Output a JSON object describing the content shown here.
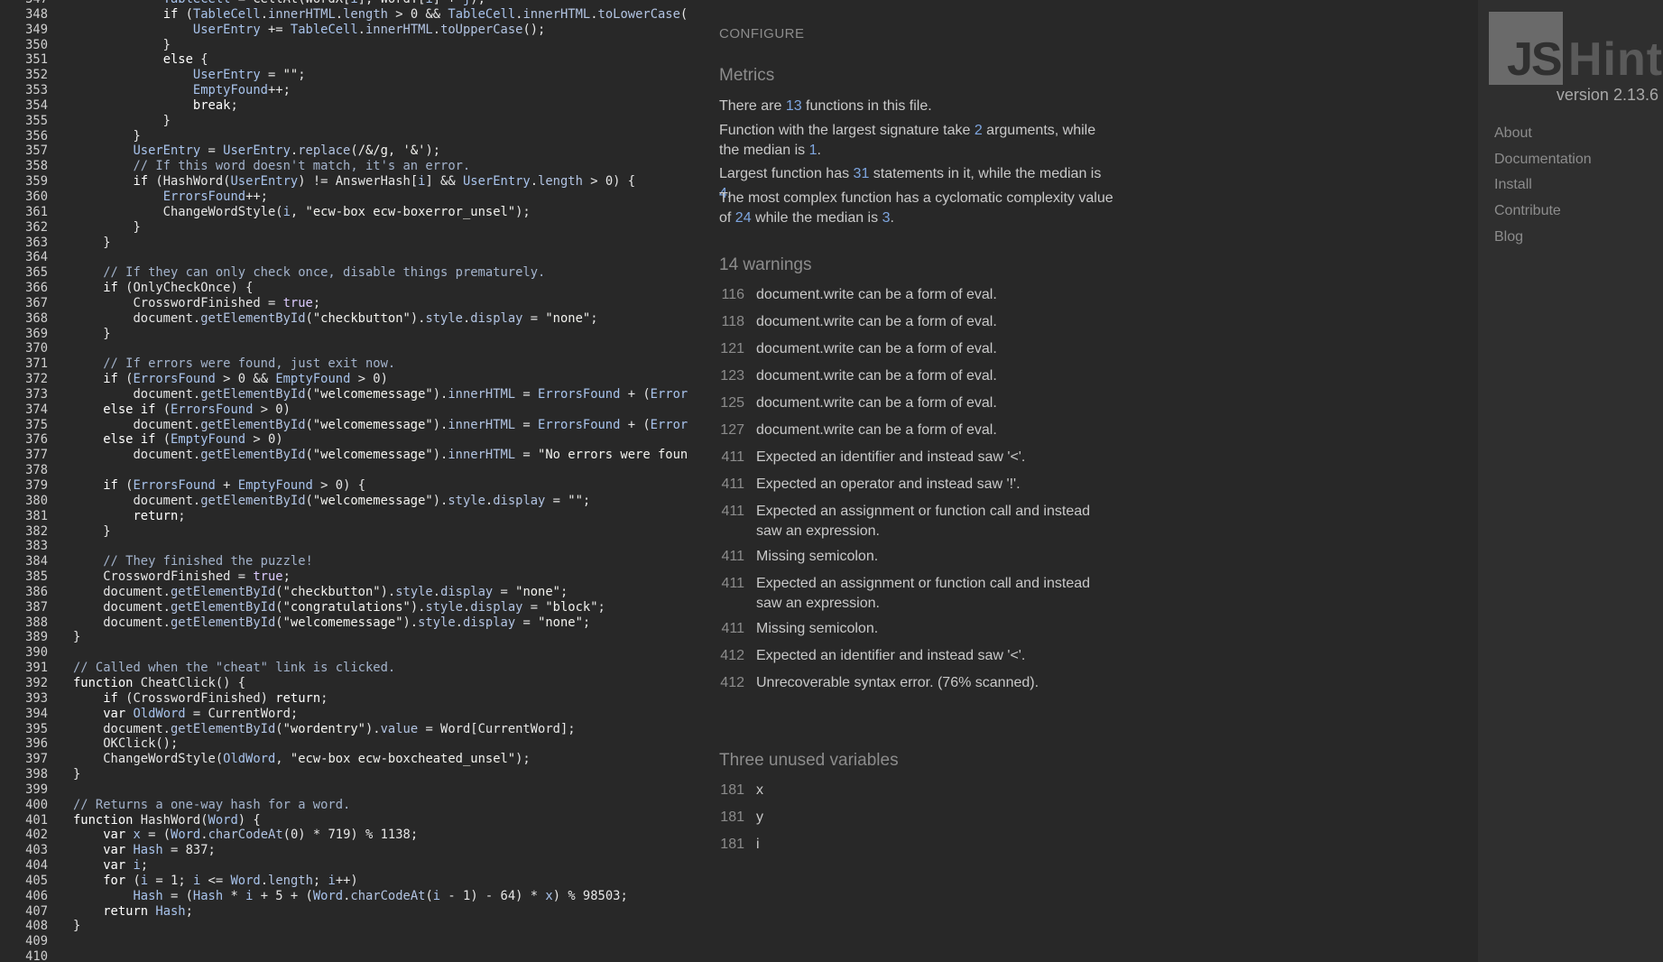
{
  "sidebar": {
    "logo_js": "JS",
    "logo_hint": "Hint",
    "version": "version 2.13.6",
    "nav": [
      "About",
      "Documentation",
      "Install",
      "Contribute",
      "Blog"
    ]
  },
  "report": {
    "configure_label": "CONFIGURE",
    "metrics_title": "Metrics",
    "metrics": {
      "functions_count": "13",
      "largest_signature": "2",
      "signature_median": "1",
      "largest_statements": "31",
      "statements_median": "4",
      "complexity_max": "24",
      "complexity_median": "3"
    },
    "warnings_title": "14 warnings",
    "warnings": [
      {
        "line": "116",
        "msg": "document.write can be a form of eval."
      },
      {
        "line": "118",
        "msg": "document.write can be a form of eval."
      },
      {
        "line": "121",
        "msg": "document.write can be a form of eval."
      },
      {
        "line": "123",
        "msg": "document.write can be a form of eval."
      },
      {
        "line": "125",
        "msg": "document.write can be a form of eval."
      },
      {
        "line": "127",
        "msg": "document.write can be a form of eval."
      },
      {
        "line": "411",
        "msg": "Expected an identifier and instead saw '<'."
      },
      {
        "line": "411",
        "msg": "Expected an operator and instead saw '!'."
      },
      {
        "line": "411",
        "msg": "Expected an assignment or function call and instead saw an expression."
      },
      {
        "line": "411",
        "msg": "Missing semicolon."
      },
      {
        "line": "411",
        "msg": "Expected an assignment or function call and instead saw an expression."
      },
      {
        "line": "411",
        "msg": "Missing semicolon."
      },
      {
        "line": "412",
        "msg": "Expected an identifier and instead saw '<'."
      },
      {
        "line": "412",
        "msg": "Unrecoverable syntax error. (76% scanned)."
      }
    ],
    "unused_title": "Three unused variables",
    "unused": [
      {
        "line": "181",
        "name": "x"
      },
      {
        "line": "181",
        "name": "y"
      },
      {
        "line": "181",
        "name": "i"
      }
    ]
  },
  "editor": {
    "lines": [
      {
        "n": "347",
        "html": "            <span class=\"var\">TableCell</span> = CellAt(WordX[<span class=\"var\">i</span>], WordY[<span class=\"var\">i</span>] + <span class=\"var\">j</span>);"
      },
      {
        "n": "348",
        "html": "            <span class=\"kw\">if</span> (<span class=\"var\">TableCell</span>.<span class=\"mth\">innerHTML</span>.<span class=\"mth\">length</span> > 0 && <span class=\"var\">TableCell</span>.<span class=\"mth\">innerHTML</span>.<span class=\"mth\">toLowerCase</span>("
      },
      {
        "n": "349",
        "html": "                <span class=\"var\">UserEntry</span> += <span class=\"var\">TableCell</span>.<span class=\"mth\">innerHTML</span>.<span class=\"mth\">toUpperCase</span>();"
      },
      {
        "n": "350",
        "html": "            }"
      },
      {
        "n": "351",
        "html": "            <span class=\"kw\">else</span> {"
      },
      {
        "n": "352",
        "html": "                <span class=\"var\">UserEntry</span> = <span class=\"str\">\"\"</span>;"
      },
      {
        "n": "353",
        "html": "                <span class=\"var\">EmptyFound</span>++;"
      },
      {
        "n": "354",
        "html": "                <span class=\"kw\">break</span>;"
      },
      {
        "n": "355",
        "html": "            }"
      },
      {
        "n": "356",
        "html": "        }"
      },
      {
        "n": "357",
        "html": "        <span class=\"var\">UserEntry</span> = <span class=\"var\">UserEntry</span>.<span class=\"mth\">replace</span>(<span class=\"str\">/&AMP;/g</span>, <span class=\"str\">'&'</span>);"
      },
      {
        "n": "358",
        "html": "        <span class=\"cmt\">// If this word doesn't match, it's an error.</span>"
      },
      {
        "n": "359",
        "html": "        <span class=\"kw\">if</span> (HashWord(<span class=\"var\">UserEntry</span>) != AnswerHash[<span class=\"var\">i</span>] && <span class=\"var\">UserEntry</span>.<span class=\"mth\">length</span> > 0) {"
      },
      {
        "n": "360",
        "html": "            <span class=\"var\">ErrorsFound</span>++;"
      },
      {
        "n": "361",
        "html": "            ChangeWordStyle(<span class=\"var\">i</span>, <span class=\"str\">\"ecw-box ecw-boxerror_unsel\"</span>);"
      },
      {
        "n": "362",
        "html": "        }"
      },
      {
        "n": "363",
        "html": "    }"
      },
      {
        "n": "364",
        "html": ""
      },
      {
        "n": "365",
        "html": "    <span class=\"cmt\">// If they can only check once, disable things prematurely.</span>"
      },
      {
        "n": "366",
        "html": "    <span class=\"kw\">if</span> (OnlyCheckOnce) {"
      },
      {
        "n": "367",
        "html": "        CrosswordFinished = <span class=\"bool\">true</span>;"
      },
      {
        "n": "368",
        "html": "        document.<span class=\"mth\">getElementById</span>(<span class=\"str\">\"checkbutton\"</span>).<span class=\"mth\">style</span>.<span class=\"mth\">display</span> = <span class=\"str\">\"none\"</span>;"
      },
      {
        "n": "369",
        "html": "    }"
      },
      {
        "n": "370",
        "html": ""
      },
      {
        "n": "371",
        "html": "    <span class=\"cmt\">// If errors were found, just exit now.</span>"
      },
      {
        "n": "372",
        "html": "    <span class=\"kw\">if</span> (<span class=\"var\">ErrorsFound</span> > 0 && <span class=\"var\">EmptyFound</span> > 0)"
      },
      {
        "n": "373",
        "html": "        document.<span class=\"mth\">getElementById</span>(<span class=\"str\">\"welcomemessage\"</span>).<span class=\"mth\">innerHTML</span> = <span class=\"var\">ErrorsFound</span> + (<span class=\"var\">Error</span>"
      },
      {
        "n": "374",
        "html": "    <span class=\"kw\">else if</span> (<span class=\"var\">ErrorsFound</span> > 0)"
      },
      {
        "n": "375",
        "html": "        document.<span class=\"mth\">getElementById</span>(<span class=\"str\">\"welcomemessage\"</span>).<span class=\"mth\">innerHTML</span> = <span class=\"var\">ErrorsFound</span> + (<span class=\"var\">Error</span>"
      },
      {
        "n": "376",
        "html": "    <span class=\"kw\">else if</span> (<span class=\"var\">EmptyFound</span> > 0)"
      },
      {
        "n": "377",
        "html": "        document.<span class=\"mth\">getElementById</span>(<span class=\"str\">\"welcomemessage\"</span>).<span class=\"mth\">innerHTML</span> = <span class=\"str\">\"No errors were foun</span>"
      },
      {
        "n": "378",
        "html": ""
      },
      {
        "n": "379",
        "html": "    <span class=\"kw\">if</span> (<span class=\"var\">ErrorsFound</span> + <span class=\"var\">EmptyFound</span> > 0) {"
      },
      {
        "n": "380",
        "html": "        document.<span class=\"mth\">getElementById</span>(<span class=\"str\">\"welcomemessage\"</span>).<span class=\"mth\">style</span>.<span class=\"mth\">display</span> = <span class=\"str\">\"\"</span>;"
      },
      {
        "n": "381",
        "html": "        <span class=\"kw\">return</span>;"
      },
      {
        "n": "382",
        "html": "    }"
      },
      {
        "n": "383",
        "html": ""
      },
      {
        "n": "384",
        "html": "    <span class=\"cmt\">// They finished the puzzle!</span>"
      },
      {
        "n": "385",
        "html": "    CrosswordFinished = <span class=\"bool\">true</span>;"
      },
      {
        "n": "386",
        "html": "    document.<span class=\"mth\">getElementById</span>(<span class=\"str\">\"checkbutton\"</span>).<span class=\"mth\">style</span>.<span class=\"mth\">display</span> = <span class=\"str\">\"none\"</span>;"
      },
      {
        "n": "387",
        "html": "    document.<span class=\"mth\">getElementById</span>(<span class=\"str\">\"congratulations\"</span>).<span class=\"mth\">style</span>.<span class=\"mth\">display</span> = <span class=\"str\">\"block\"</span>;"
      },
      {
        "n": "388",
        "html": "    document.<span class=\"mth\">getElementById</span>(<span class=\"str\">\"welcomemessage\"</span>).<span class=\"mth\">style</span>.<span class=\"mth\">display</span> = <span class=\"str\">\"none\"</span>;"
      },
      {
        "n": "389",
        "html": "}"
      },
      {
        "n": "390",
        "html": ""
      },
      {
        "n": "391",
        "html": "<span class=\"cmt\">// Called when the \"cheat\" link is clicked.</span>"
      },
      {
        "n": "392",
        "html": "<span class=\"kw\">function</span> CheatClick() {"
      },
      {
        "n": "393",
        "html": "    <span class=\"kw\">if</span> (CrosswordFinished) <span class=\"kw\">return</span>;"
      },
      {
        "n": "394",
        "html": "    <span class=\"kw\">var</span> <span class=\"var\">OldWord</span> = CurrentWord;"
      },
      {
        "n": "395",
        "html": "    document.<span class=\"mth\">getElementById</span>(<span class=\"str\">\"wordentry\"</span>).<span class=\"mth\">value</span> = Word[CurrentWord];"
      },
      {
        "n": "396",
        "html": "    OKClick();"
      },
      {
        "n": "397",
        "html": "    ChangeWordStyle(<span class=\"var\">OldWord</span>, <span class=\"str\">\"ecw-box ecw-boxcheated_unsel\"</span>);"
      },
      {
        "n": "398",
        "html": "}"
      },
      {
        "n": "399",
        "html": ""
      },
      {
        "n": "400",
        "html": "<span class=\"cmt\">// Returns a one-way hash for a word.</span>"
      },
      {
        "n": "401",
        "html": "<span class=\"kw\">function</span> HashWord(<span class=\"var\">Word</span>) {"
      },
      {
        "n": "402",
        "html": "    <span class=\"kw\">var</span> <span class=\"var\">x</span> = (<span class=\"var\">Word</span>.<span class=\"mth\">charCodeAt</span>(0) * 719) % 1138;"
      },
      {
        "n": "403",
        "html": "    <span class=\"kw\">var</span> <span class=\"var\">Hash</span> = 837;"
      },
      {
        "n": "404",
        "html": "    <span class=\"kw\">var</span> <span class=\"var\">i</span>;"
      },
      {
        "n": "405",
        "html": "    <span class=\"kw\">for</span> (<span class=\"var\">i</span> = 1; <span class=\"var\">i</span> <= <span class=\"var\">Word</span>.<span class=\"mth\">length</span>; <span class=\"var\">i</span>++)"
      },
      {
        "n": "406",
        "html": "        <span class=\"var\">Hash</span> = (<span class=\"var\">Hash</span> * <span class=\"var\">i</span> + 5 + (<span class=\"var\">Word</span>.<span class=\"mth\">charCodeAt</span>(<span class=\"var\">i</span> - 1) - 64) * <span class=\"var\">x</span>) % 98503;"
      },
      {
        "n": "407",
        "html": "    <span class=\"kw\">return</span> <span class=\"var\">Hash</span>;"
      },
      {
        "n": "408",
        "html": "}"
      },
      {
        "n": "409",
        "html": ""
      },
      {
        "n": "410",
        "html": ""
      }
    ]
  }
}
